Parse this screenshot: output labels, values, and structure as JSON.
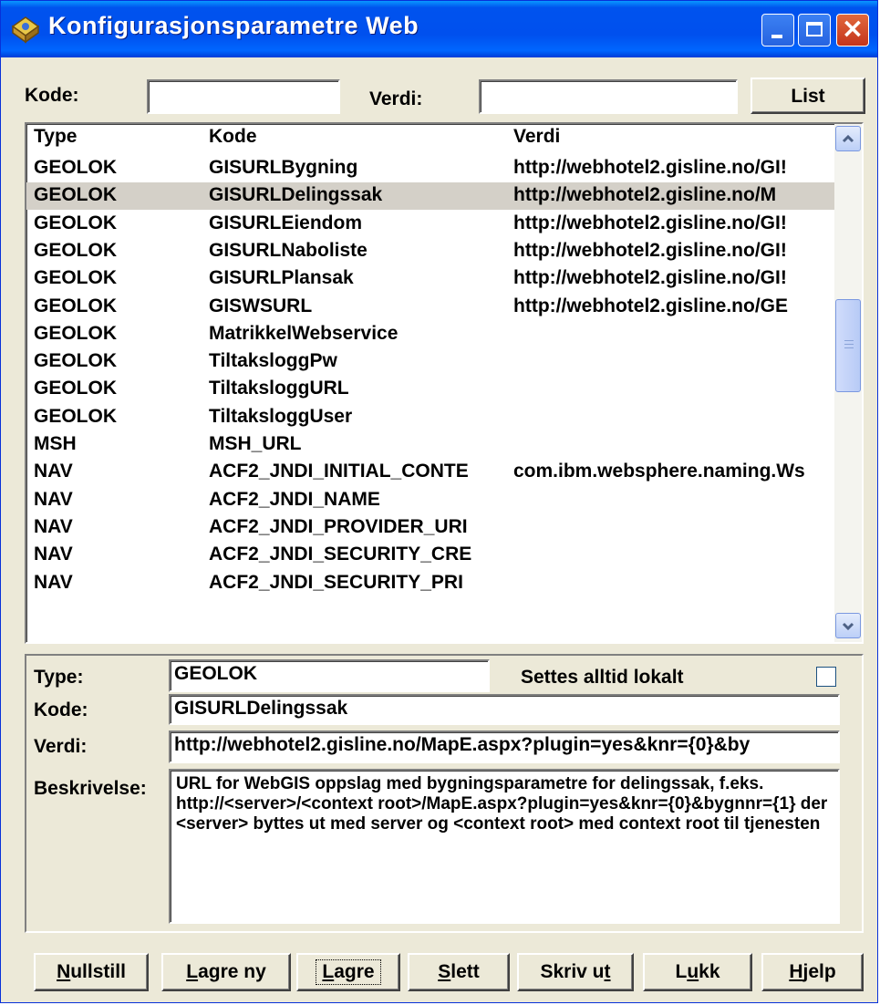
{
  "window": {
    "title": "Konfigurasjonsparametre Web"
  },
  "search": {
    "kode_label": "Kode:",
    "kode_value": "",
    "verdi_label": "Verdi:",
    "verdi_value": "",
    "list_button": "List"
  },
  "list": {
    "headers": [
      "Type",
      "Kode",
      "Verdi"
    ],
    "rows": [
      {
        "type": "GEOLOK",
        "kode": "GISURLBygning",
        "verdi": "http://webhotel2.gisline.no/GI!"
      },
      {
        "type": "GEOLOK",
        "kode": "GISURLDelingssak",
        "verdi": " http://webhotel2.gisline.no/M"
      },
      {
        "type": "GEOLOK",
        "kode": "GISURLEiendom",
        "verdi": "http://webhotel2.gisline.no/GI!"
      },
      {
        "type": "GEOLOK",
        "kode": "GISURLNaboliste",
        "verdi": "http://webhotel2.gisline.no/GI!"
      },
      {
        "type": "GEOLOK",
        "kode": "GISURLPlansak",
        "verdi": "http://webhotel2.gisline.no/GI!"
      },
      {
        "type": "GEOLOK",
        "kode": "GISWSURL",
        "verdi": "http://webhotel2.gisline.no/GE"
      },
      {
        "type": "GEOLOK",
        "kode": "MatrikkelWebservice",
        "verdi": ""
      },
      {
        "type": "GEOLOK",
        "kode": "TiltaksloggPw",
        "verdi": ""
      },
      {
        "type": "GEOLOK",
        "kode": "TiltaksloggURL",
        "verdi": ""
      },
      {
        "type": "GEOLOK",
        "kode": "TiltaksloggUser",
        "verdi": ""
      },
      {
        "type": "MSH",
        "kode": "MSH_URL",
        "verdi": ""
      },
      {
        "type": "NAV",
        "kode": "ACF2_JNDI_INITIAL_CONTE",
        "verdi": "com.ibm.websphere.naming.Ws"
      },
      {
        "type": "NAV",
        "kode": "ACF2_JNDI_NAME",
        "verdi": ""
      },
      {
        "type": "NAV",
        "kode": "ACF2_JNDI_PROVIDER_URI",
        "verdi": ""
      },
      {
        "type": "NAV",
        "kode": "ACF2_JNDI_SECURITY_CRE",
        "verdi": ""
      },
      {
        "type": "NAV",
        "kode": "ACF2_JNDI_SECURITY_PRI",
        "verdi": ""
      }
    ]
  },
  "detail": {
    "type_label": "Type:",
    "type_value": "GEOLOK",
    "local_label": "Settes alltid lokalt",
    "local_checked": false,
    "kode_label": "Kode:",
    "kode_value": "GISURLDelingssak",
    "verdi_label": "Verdi:",
    "verdi_value": " http://webhotel2.gisline.no/MapE.aspx?plugin=yes&knr={0}&by",
    "beskrivelse_label": "Beskrivelse:",
    "beskrivelse_value": "URL for WebGIS oppslag med bygningsparametre for delingssak, f.eks. http://<server>/<context root>/MapE.aspx?plugin=yes&knr={0}&bygnnr={1} der <server> byttes ut med server og <context root> med context root til tjenesten"
  },
  "buttons": {
    "nullstill": "Nullstill",
    "lagre_ny": "Lagre ny",
    "lagre": "Lagre",
    "slett": "Slett",
    "skriv_ut": "Skriv ut",
    "lukk": "Lukk",
    "hjelp": "Hjelp"
  },
  "icons": {
    "title_icon": "settings-app-icon",
    "minimize": "minimize-icon",
    "maximize": "maximize-icon",
    "close": "close-icon",
    "scroll_up": "chevron-up-icon",
    "scroll_down": "chevron-down-icon"
  }
}
